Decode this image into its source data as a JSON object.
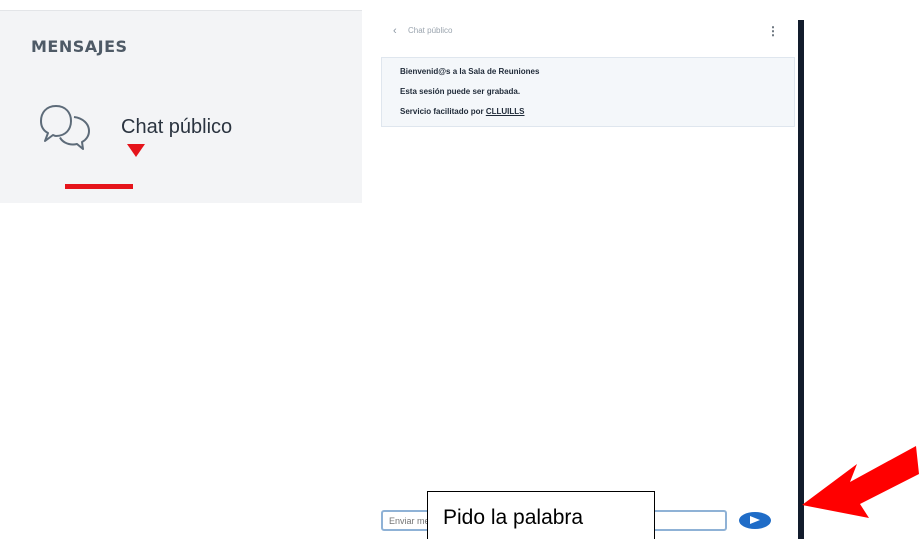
{
  "messages_panel": {
    "title": "MENSAJES",
    "chat_item": {
      "label": "Chat público",
      "icon": "chat-bubbles-icon"
    }
  },
  "chat": {
    "header": {
      "back_icon": "‹",
      "title": "Chat público",
      "menu_icon": "⋮"
    },
    "welcome": {
      "line1": "Bienvenid@s a la Sala de Reuniones",
      "line2": "Esta sesión puede ser grabada.",
      "line3_prefix": "Servicio facilitado por ",
      "line3_link": "CLLUILLS"
    },
    "input": {
      "placeholder": "Enviar mensaje al chat público"
    },
    "send_icon": "send-arrow-icon"
  },
  "annotation": {
    "callout_text": "Pido la palabra"
  },
  "colors": {
    "accent_red": "#e5141b",
    "send_blue": "#1f6cc7",
    "divider_dark": "#121c2c",
    "panel_gray": "#f3f4f6"
  }
}
